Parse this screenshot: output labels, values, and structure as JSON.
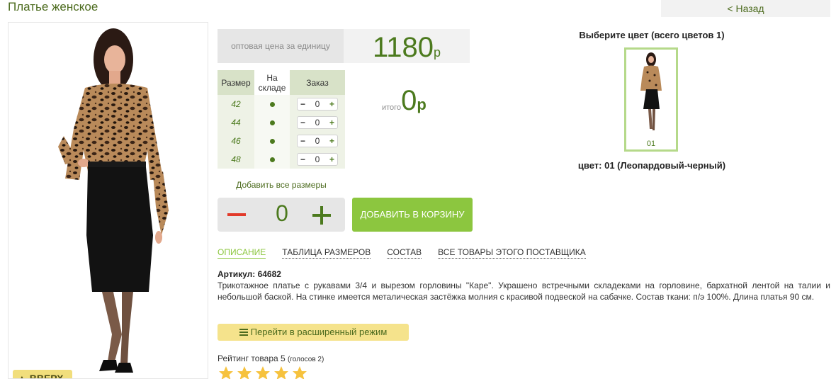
{
  "page": {
    "title": "Платье женское",
    "back_label": "< Назад"
  },
  "photo": {
    "up_label": "▲ ВВЕРХ"
  },
  "price": {
    "label": "оптовая цена за единицу",
    "value": "1180",
    "currency": "р"
  },
  "sizes": {
    "headers": {
      "size": "Размер",
      "stock": "На складе",
      "order": "Заказ"
    },
    "rows": [
      {
        "size": "42",
        "qty": "0"
      },
      {
        "size": "44",
        "qty": "0"
      },
      {
        "size": "46",
        "qty": "0"
      },
      {
        "size": "48",
        "qty": "0"
      }
    ]
  },
  "total": {
    "label": "итого",
    "value": "0",
    "currency": "р"
  },
  "add_all_label": "Добавить все размеры",
  "quantity": {
    "value": "0"
  },
  "cart_button_label": "ДОБАВИТЬ В КОРЗИНУ",
  "tabs": [
    {
      "label": "ОПИСАНИЕ"
    },
    {
      "label": "ТАБЛИЦА РАЗМЕРОВ"
    },
    {
      "label": "СОСТАВ"
    },
    {
      "label": "ВСЕ ТОВАРЫ ЭТОГО ПОСТАВЩИКА"
    }
  ],
  "article": "Артикул: 64682",
  "description": " Трикотажное платье с рукавами 3/4 и вырезом горловины \"Каре\". Украшено встречными складеками на горловине, бархатной лентой на талии и небольшой баской. На стинке имеется металическая застёжка молния с красивой подвеской на сабачке. Состав ткани: п/э 100%. Длина платья 90 см.",
  "extended_mode_label": "Перейти в расширенный режим",
  "rating": {
    "text": "Рейтинг товара 5",
    "votes": "(голосов 2)",
    "stars": 5
  },
  "colors": {
    "title": "Выберите цвет (всего цветов 1)",
    "items": [
      {
        "number": "01"
      }
    ],
    "selected_label": "цвет: 01 (Леопардовый-черный)"
  },
  "theme": {
    "accent": "#8cc63f",
    "text_green": "#4c7a1e"
  }
}
